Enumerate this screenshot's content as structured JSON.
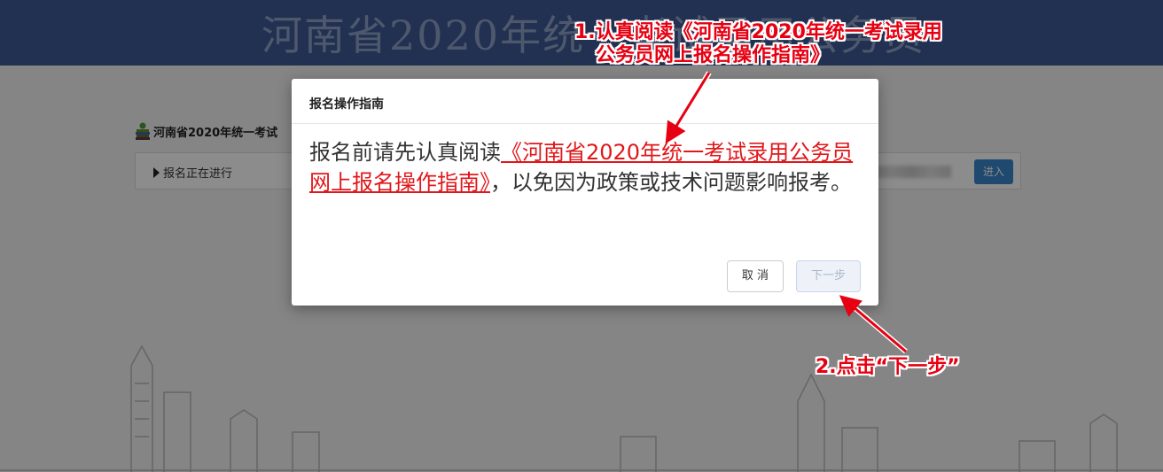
{
  "banner": {
    "title": "河南省2020年统一考试录用公务员"
  },
  "card": {
    "title": "河南省2020年统一考试",
    "status": "报名正在进行",
    "enter_label": "进入"
  },
  "modal": {
    "title": "报名操作指南",
    "body_prefix": "报名前请先认真阅读",
    "guide_link": "《河南省2020年统一考试录用公务员网上报名操作指南》",
    "body_suffix": "，以免因为政策或技术问题影响报考。",
    "cancel_label": "取 消",
    "next_label": "下一步"
  },
  "annotations": {
    "step1_line1": "1.认真阅读《河南省2020年统一考试录用",
    "step1_line2": "公务员网上报名操作指南》",
    "step2": "2.点击“下一步”"
  },
  "colors": {
    "header": "#3f5a94",
    "link": "#e0171b",
    "annotation": "#e60012",
    "enter_button": "#3a86c8"
  }
}
